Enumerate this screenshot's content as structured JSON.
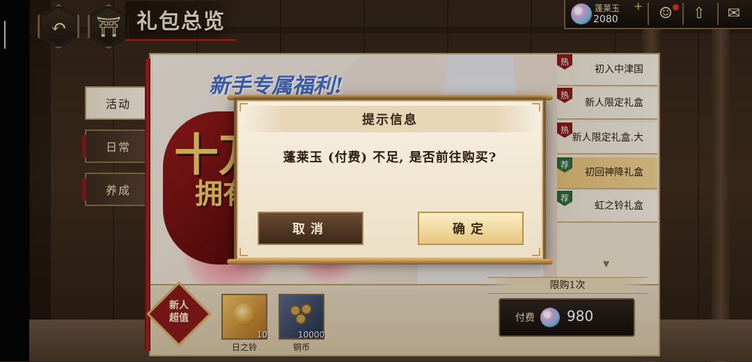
{
  "header": {
    "title": "礼包总览",
    "currency": {
      "name": "蓬莱玉",
      "amount": "2080",
      "plus": "+"
    }
  },
  "tabs": [
    {
      "label": "活动",
      "active": true
    },
    {
      "label": "日常",
      "active": false
    },
    {
      "label": "养成",
      "active": false
    }
  ],
  "banner": {
    "headline": "新手专属福利!",
    "big_text": "十万",
    "big_text_2": "拥有"
  },
  "packs": [
    {
      "label": "初入中津国",
      "badge": "热",
      "badge_type": "hot",
      "active": false
    },
    {
      "label": "新人限定礼盒",
      "badge": "热",
      "badge_type": "hot",
      "active": false
    },
    {
      "label": "新人限定礼盒.大",
      "badge": "热",
      "badge_type": "hot",
      "active": false
    },
    {
      "label": "初回神降礼盒",
      "badge": "荐",
      "badge_type": "rec",
      "active": true
    },
    {
      "label": "虹之铃礼盒",
      "badge": "荐",
      "badge_type": "rec",
      "active": false
    }
  ],
  "bottom": {
    "new_badge_line1": "新人",
    "new_badge_line2": "超值",
    "items": [
      {
        "name": "日之铃",
        "qty": "10"
      },
      {
        "name": "铜币",
        "qty": "10000"
      }
    ],
    "limit_text": "限购1次",
    "pay_label": "付费",
    "price": "980"
  },
  "dialog": {
    "title": "提示信息",
    "message": "蓬莱玉 (付费) 不足, 是否前往购买?",
    "cancel_label": "取消",
    "confirm_label": "确定"
  },
  "colors": {
    "accent_red": "#8b1c1c",
    "gold": "#d9b06a",
    "dark": "#2a2018"
  }
}
